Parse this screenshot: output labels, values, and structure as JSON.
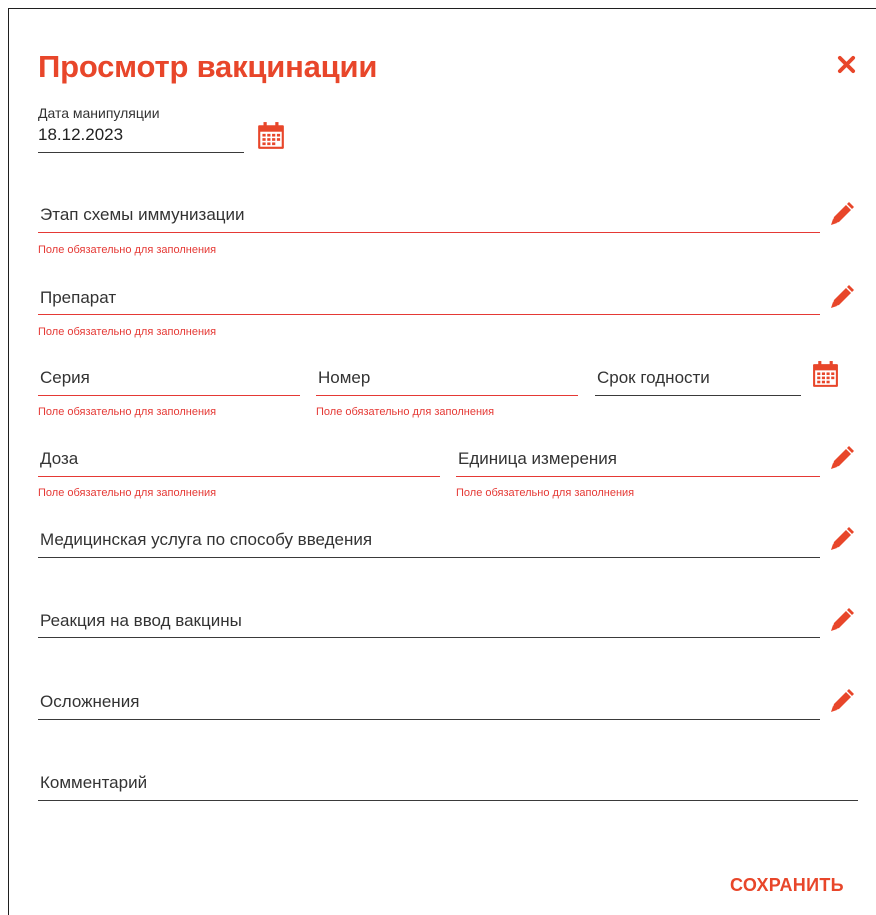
{
  "dialog": {
    "title": "Просмотр вакцинации",
    "save_label": "СОХРАНИТЬ"
  },
  "error_text": "Поле обязательно для заполнения",
  "fields": {
    "date": {
      "label": "Дата манипуляции",
      "value": "18.12.2023"
    },
    "stage": {
      "placeholder": "Этап схемы иммунизации",
      "error": "Поле обязательно для заполнения"
    },
    "drug": {
      "placeholder": "Препарат",
      "error": "Поле обязательно для заполнения"
    },
    "series": {
      "placeholder": "Серия",
      "error": "Поле обязательно для заполнения"
    },
    "number": {
      "placeholder": "Номер",
      "error": "Поле обязательно для заполнения"
    },
    "expiry": {
      "placeholder": "Срок годности"
    },
    "dose": {
      "placeholder": "Доза",
      "error": "Поле обязательно для заполнения"
    },
    "unit": {
      "placeholder": "Единица измерения",
      "error": "Поле обязательно для заполнения"
    },
    "service": {
      "placeholder": "Медицинская услуга по способу введения"
    },
    "reaction": {
      "placeholder": "Реакция на ввод вакцины"
    },
    "complications": {
      "placeholder": "Осложнения"
    },
    "comment": {
      "placeholder": "Комментарий"
    }
  },
  "icons": {
    "close": "close-icon",
    "calendar": "calendar-icon",
    "edit": "pencil-icon"
  },
  "colors": {
    "accent": "#e8462a",
    "error": "#e53935"
  }
}
